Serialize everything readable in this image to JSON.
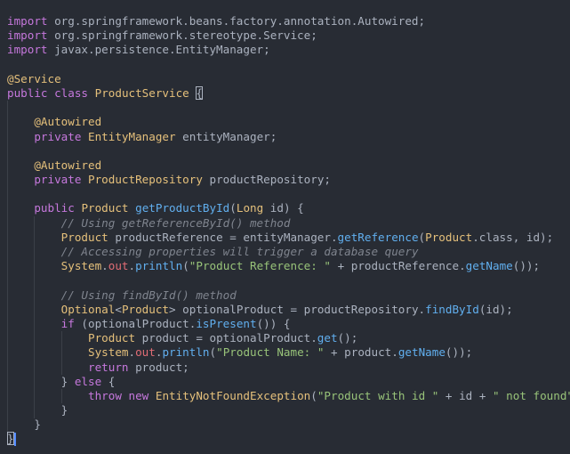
{
  "editor": {
    "lines": [
      [
        [
          "k",
          "import"
        ],
        [
          "p",
          " org.springframework.beans.factory.annotation.Autowired;"
        ]
      ],
      [
        [
          "k",
          "import"
        ],
        [
          "p",
          " org.springframework.stereotype.Service;"
        ]
      ],
      [
        [
          "k",
          "import"
        ],
        [
          "p",
          " javax.persistence.EntityManager;"
        ]
      ],
      [],
      [
        [
          "a",
          "@Service"
        ]
      ],
      [
        [
          "k",
          "public"
        ],
        [
          "p",
          " "
        ],
        [
          "k",
          "class"
        ],
        [
          "p",
          " "
        ],
        [
          "t",
          "ProductService"
        ],
        [
          "p",
          " "
        ],
        [
          "bracket",
          "{"
        ]
      ],
      [],
      [
        [
          "p",
          "    "
        ],
        [
          "a",
          "@Autowired"
        ]
      ],
      [
        [
          "p",
          "    "
        ],
        [
          "k",
          "private"
        ],
        [
          "p",
          " "
        ],
        [
          "t",
          "EntityManager"
        ],
        [
          "p",
          " entityManager;"
        ]
      ],
      [],
      [
        [
          "p",
          "    "
        ],
        [
          "a",
          "@Autowired"
        ]
      ],
      [
        [
          "p",
          "    "
        ],
        [
          "k",
          "private"
        ],
        [
          "p",
          " "
        ],
        [
          "t",
          "ProductRepository"
        ],
        [
          "p",
          " productRepository;"
        ]
      ],
      [],
      [
        [
          "p",
          "    "
        ],
        [
          "k",
          "public"
        ],
        [
          "p",
          " "
        ],
        [
          "t",
          "Product"
        ],
        [
          "p",
          " "
        ],
        [
          "f",
          "getProductById"
        ],
        [
          "p",
          "("
        ],
        [
          "t",
          "Long"
        ],
        [
          "p",
          " id) {"
        ]
      ],
      [
        [
          "p",
          "        "
        ],
        [
          "c",
          "// Using getReferenceById() method"
        ]
      ],
      [
        [
          "p",
          "        "
        ],
        [
          "t",
          "Product"
        ],
        [
          "p",
          " productReference = entityManager."
        ],
        [
          "f",
          "getReference"
        ],
        [
          "p",
          "("
        ],
        [
          "t",
          "Product"
        ],
        [
          "p",
          ".class, id);"
        ]
      ],
      [
        [
          "p",
          "        "
        ],
        [
          "c",
          "// Accessing properties will trigger a database query"
        ]
      ],
      [
        [
          "p",
          "        "
        ],
        [
          "t",
          "System"
        ],
        [
          "p",
          "."
        ],
        [
          "v",
          "out"
        ],
        [
          "p",
          "."
        ],
        [
          "f",
          "println"
        ],
        [
          "p",
          "("
        ],
        [
          "s",
          "\"Product Reference: \""
        ],
        [
          "p",
          " + productReference."
        ],
        [
          "f",
          "getName"
        ],
        [
          "p",
          "());"
        ]
      ],
      [],
      [
        [
          "p",
          "        "
        ],
        [
          "c",
          "// Using findById() method"
        ]
      ],
      [
        [
          "p",
          "        "
        ],
        [
          "t",
          "Optional"
        ],
        [
          "p",
          "<"
        ],
        [
          "t",
          "Product"
        ],
        [
          "p",
          "> optionalProduct = productRepository."
        ],
        [
          "f",
          "findById"
        ],
        [
          "p",
          "(id);"
        ]
      ],
      [
        [
          "p",
          "        "
        ],
        [
          "k",
          "if"
        ],
        [
          "p",
          " (optionalProduct."
        ],
        [
          "f",
          "isPresent"
        ],
        [
          "p",
          "()) {"
        ]
      ],
      [
        [
          "p",
          "            "
        ],
        [
          "t",
          "Product"
        ],
        [
          "p",
          " product = optionalProduct."
        ],
        [
          "f",
          "get"
        ],
        [
          "p",
          "();"
        ]
      ],
      [
        [
          "p",
          "            "
        ],
        [
          "t",
          "System"
        ],
        [
          "p",
          "."
        ],
        [
          "v",
          "out"
        ],
        [
          "p",
          "."
        ],
        [
          "f",
          "println"
        ],
        [
          "p",
          "("
        ],
        [
          "s",
          "\"Product Name: \""
        ],
        [
          "p",
          " + product."
        ],
        [
          "f",
          "getName"
        ],
        [
          "p",
          "());"
        ]
      ],
      [
        [
          "p",
          "            "
        ],
        [
          "k",
          "return"
        ],
        [
          "p",
          " product;"
        ]
      ],
      [
        [
          "p",
          "        } "
        ],
        [
          "k",
          "else"
        ],
        [
          "p",
          " {"
        ]
      ],
      [
        [
          "p",
          "            "
        ],
        [
          "k",
          "throw"
        ],
        [
          "p",
          " "
        ],
        [
          "k",
          "new"
        ],
        [
          "p",
          " "
        ],
        [
          "t",
          "EntityNotFoundException"
        ],
        [
          "p",
          "("
        ],
        [
          "s",
          "\"Product with id \""
        ],
        [
          "p",
          " + id + "
        ],
        [
          "s",
          "\" not found\""
        ],
        [
          "p",
          ");"
        ]
      ],
      [
        [
          "p",
          "        }"
        ]
      ],
      [
        [
          "p",
          "    }"
        ]
      ],
      [
        [
          "bracket",
          "}"
        ]
      ]
    ]
  }
}
